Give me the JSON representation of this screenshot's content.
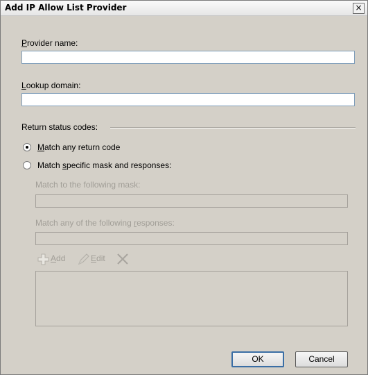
{
  "dialog": {
    "title": "Add IP Allow List Provider",
    "close_glyph": "×"
  },
  "provider_name": {
    "label_accel": "P",
    "label_rest": "rovider name:",
    "value": ""
  },
  "lookup_domain": {
    "label_accel": "L",
    "label_rest": "ookup domain:",
    "value": ""
  },
  "return_status": {
    "heading": "Return status codes:"
  },
  "options": {
    "any": {
      "accel": "M",
      "rest": "atch any return code",
      "selected": true
    },
    "specific": {
      "pre": "Match ",
      "accel": "s",
      "rest": "pecific mask and responses:",
      "selected": false
    }
  },
  "mask": {
    "label": "Match to the following mask:",
    "value": ""
  },
  "responses": {
    "label_pre": "Match any of the following ",
    "label_accel": "r",
    "label_rest": "esponses:",
    "value": ""
  },
  "toolbar": {
    "add_accel": "A",
    "add_rest": "dd",
    "edit_accel": "E",
    "edit_rest": "dit",
    "icons": [
      "add-icon",
      "edit-icon",
      "remove-icon"
    ]
  },
  "buttons": {
    "ok": "OK",
    "cancel": "Cancel"
  },
  "colors": {
    "dialog_bg": "#d4d0c8",
    "disabled_text": "#a19e97",
    "input_border": "#7f9db9"
  }
}
